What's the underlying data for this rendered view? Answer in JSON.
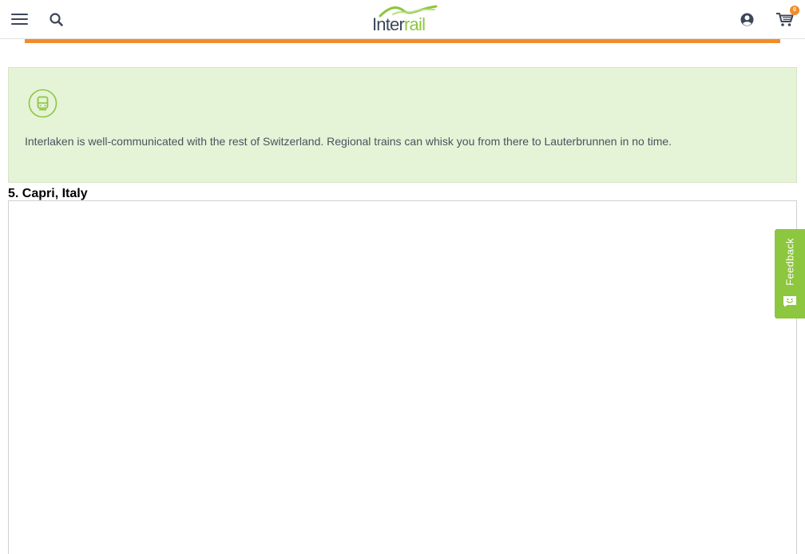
{
  "header": {
    "menu_icon": "hamburger-menu-icon",
    "search_icon": "search-icon",
    "logo": {
      "inter": "Inter",
      "rail": "rail"
    },
    "account_icon": "user-account-icon",
    "cart_icon": "shopping-cart-icon",
    "cart_count": "0"
  },
  "info_box": {
    "icon": "train-icon",
    "text": "Interlaken is well-communicated with the rest of Switzerland. Regional trains can whisk you from there to Lauterbrunnen in no time."
  },
  "section": {
    "title": "5. Capri, Italy"
  },
  "feedback": {
    "label": "Feedback",
    "icon": "feedback-smiley-icon"
  },
  "colors": {
    "accent_orange": "#f28c28",
    "brand_green": "#8dc63f",
    "info_bg": "#e5f3d7",
    "navy": "#3b4757"
  }
}
